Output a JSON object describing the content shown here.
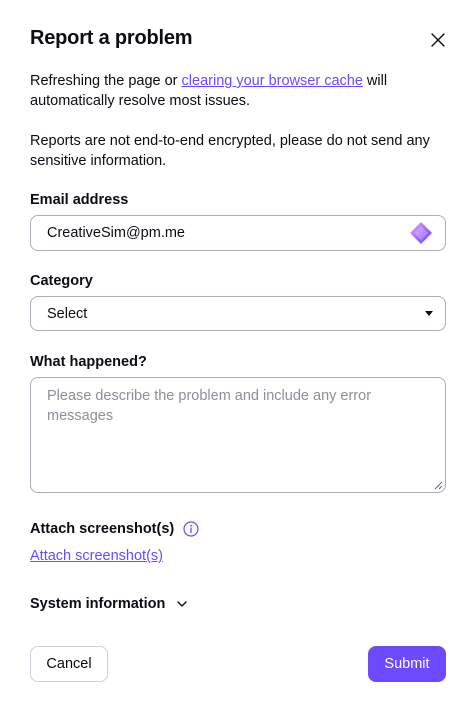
{
  "dialog": {
    "title": "Report a problem",
    "close_icon": "close-icon"
  },
  "intro": {
    "text_before_link": "Refreshing the page or ",
    "link_text": "clearing your browser cache",
    "text_after_link": " will automatically resolve most issues.",
    "encryption_note": "Reports are not end-to-end encrypted, please do not send any sensitive information."
  },
  "email": {
    "label": "Email address",
    "value": "CreativeSim@pm.me",
    "icon": "proton-pass-icon"
  },
  "category": {
    "label": "Category",
    "selected": "Select"
  },
  "description": {
    "label": "What happened?",
    "placeholder": "Please describe the problem and include any error messages",
    "value": ""
  },
  "attachments": {
    "label": "Attach screenshot(s)",
    "link": "Attach screenshot(s)",
    "info_icon": "info-icon"
  },
  "system_info": {
    "label": "System information",
    "expand_icon": "chevron-down-icon"
  },
  "actions": {
    "cancel": "Cancel",
    "submit": "Submit"
  },
  "colors": {
    "accent": "#6d4aff",
    "text": "#0c0c14",
    "border": "#adabb8",
    "placeholder": "#8f8d99"
  }
}
